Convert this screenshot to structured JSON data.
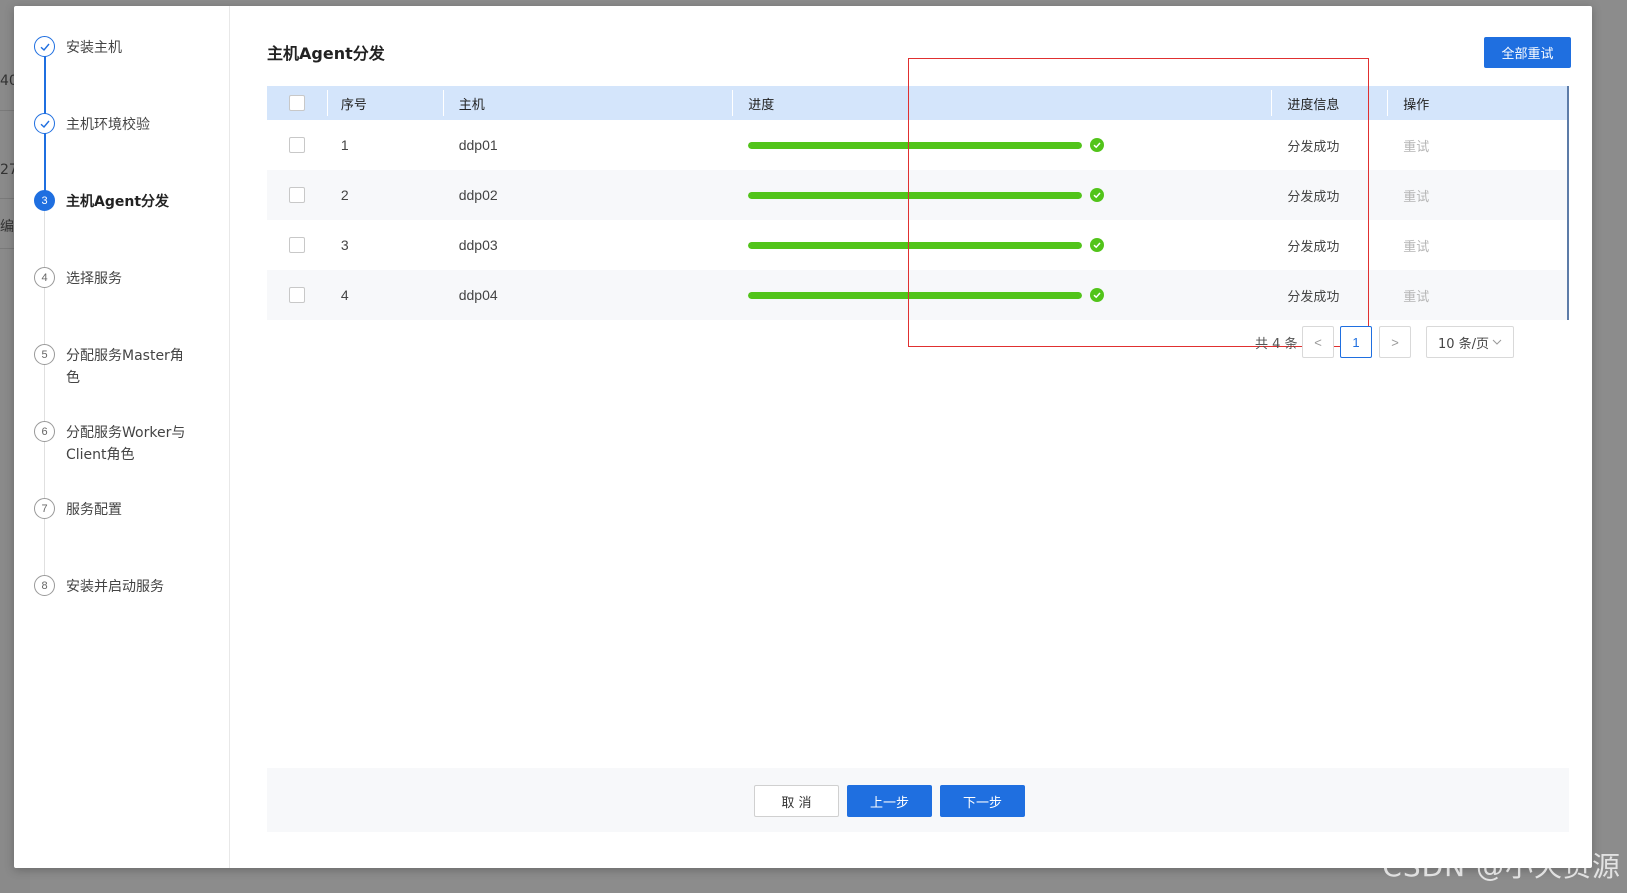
{
  "background": {
    "fragments": [
      "40",
      "27",
      "编"
    ]
  },
  "steps": [
    {
      "number": "1",
      "label": "安装主机",
      "state": "done"
    },
    {
      "number": "2",
      "label": "主机环境校验",
      "state": "done"
    },
    {
      "number": "3",
      "label": "主机Agent分发",
      "state": "active"
    },
    {
      "number": "4",
      "label": "选择服务",
      "state": "pending"
    },
    {
      "number": "5",
      "label": "分配服务Master角色",
      "state": "pending"
    },
    {
      "number": "6",
      "label": "分配服务Worker与Client角色",
      "state": "pending"
    },
    {
      "number": "7",
      "label": "服务配置",
      "state": "pending"
    },
    {
      "number": "8",
      "label": "安装并启动服务",
      "state": "pending"
    }
  ],
  "main": {
    "title": "主机Agent分发",
    "retry_all_label": "全部重试"
  },
  "table": {
    "headers": {
      "index": "序号",
      "host": "主机",
      "progress": "进度",
      "info": "进度信息",
      "action": "操作"
    },
    "rows": [
      {
        "index": "1",
        "host": "ddp01",
        "progress": 1.0,
        "info": "分发成功",
        "action": "重试"
      },
      {
        "index": "2",
        "host": "ddp02",
        "progress": 1.0,
        "info": "分发成功",
        "action": "重试"
      },
      {
        "index": "3",
        "host": "ddp03",
        "progress": 1.0,
        "info": "分发成功",
        "action": "重试"
      },
      {
        "index": "4",
        "host": "ddp04",
        "progress": 1.0,
        "info": "分发成功",
        "action": "重试"
      }
    ]
  },
  "pagination": {
    "total_text": "共 4 条",
    "prev": "<",
    "current_page": "1",
    "next": ">",
    "page_size": "10 条/页"
  },
  "footer": {
    "cancel_label": "取 消",
    "prev_label": "上一步",
    "next_label": "下一步"
  },
  "colors": {
    "primary": "#1f6fe0",
    "success": "#52c41a",
    "header_bg": "#d4e5fb",
    "highlight": "#e03030"
  },
  "watermark": "CSDN @小天资源"
}
